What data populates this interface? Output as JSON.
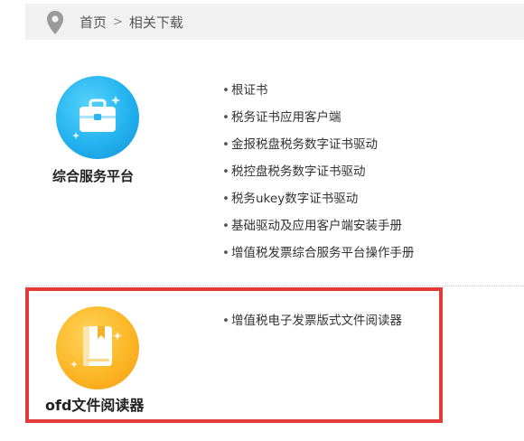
{
  "breadcrumb": {
    "home": "首页",
    "separator": ">",
    "current": "相关下载"
  },
  "sections": [
    {
      "title": "综合服务平台",
      "icon": "briefcase-icon",
      "links": [
        "根证书",
        "税务证书应用客户端",
        "金报税盘税务数字证书驱动",
        "税控盘税务数字证书驱动",
        "税务ukey数字证书驱动",
        "基础驱动及应用客户端安装手册",
        "增值税发票综合服务平台操作手册"
      ]
    },
    {
      "title": "ofd文件阅读器",
      "icon": "book-icon",
      "links": [
        "增值税电子发票版式文件阅读器"
      ]
    }
  ],
  "bullet": "•",
  "colors": {
    "highlight_border": "#e33b3b",
    "blue_icon": "#23b2ef",
    "orange_icon": "#fbb726",
    "breadcrumb_bg": "#f1f1f1"
  }
}
